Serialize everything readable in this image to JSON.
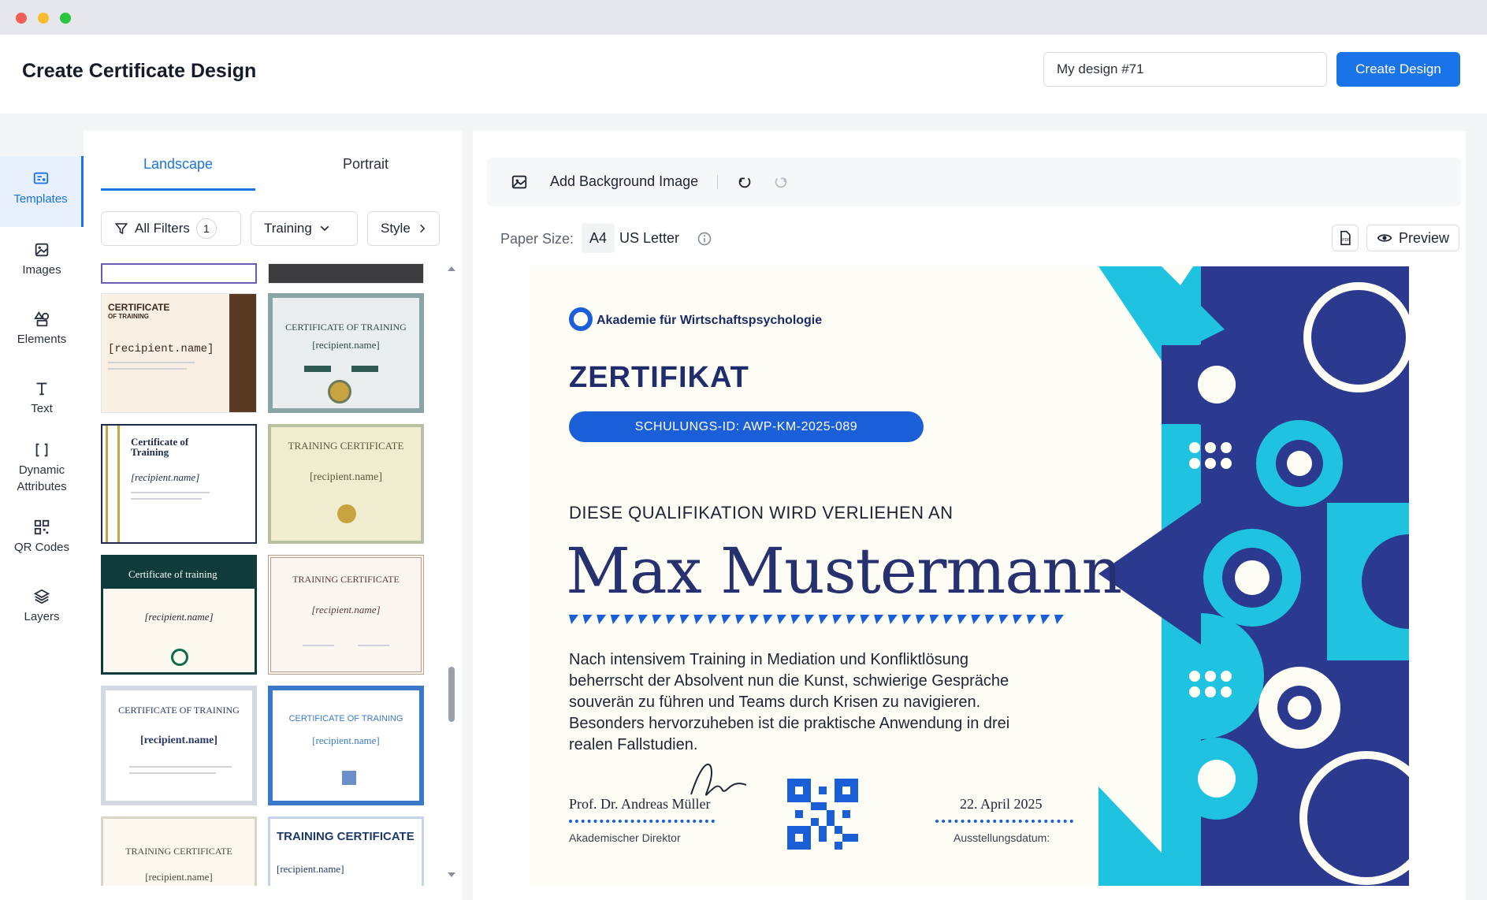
{
  "header": {
    "title": "Create Certificate Design",
    "design_name": "My design #71",
    "create_label": "Create Design"
  },
  "sidebar": {
    "items": [
      {
        "label": "Templates",
        "icon": "templates-icon"
      },
      {
        "label": "Images",
        "icon": "image-icon"
      },
      {
        "label": "Elements",
        "icon": "shapes-icon"
      },
      {
        "label": "Text",
        "icon": "text-icon"
      },
      {
        "label": "Dynamic\nAttributes",
        "icon": "brackets-icon"
      },
      {
        "label": "QR Codes",
        "icon": "qr-code-icon"
      },
      {
        "label": "Layers",
        "icon": "layers-icon"
      }
    ]
  },
  "panel": {
    "tabs": [
      "Landscape",
      "Portrait"
    ],
    "filters": {
      "all_label": "All Filters",
      "count": "1",
      "training": "Training",
      "style": "Style"
    },
    "templates": [
      {
        "title": "CERTIFICATE",
        "sub": "OF TRAINING",
        "name": "[recipient.name]"
      },
      {
        "title": "CERTIFICATE OF TRAINING",
        "name": "[recipient.name]"
      },
      {
        "title": "Certificate of Training",
        "name": "[recipient.name]"
      },
      {
        "title": "TRAINING CERTIFICATE",
        "name": "[recipient.name]"
      },
      {
        "title": "Certificate of training",
        "name": "[recipient.name]"
      },
      {
        "title": "TRAINING CERTIFICATE",
        "name": "[recipient.name]"
      },
      {
        "title": "CERTIFICATE OF TRAINING",
        "name": "[recipient.name]"
      },
      {
        "title": "CERTIFICATE OF TRAINING",
        "name": "[recipient.name]"
      },
      {
        "title": "TRAINING CERTIFICATE",
        "name": "[recipient.name]"
      },
      {
        "title": "TRAINING CERTIFICATE",
        "name": "[recipient.name]"
      }
    ]
  },
  "toolbar": {
    "add_bg": "Add Background Image",
    "paper_size_label": "Paper Size:",
    "paper_a4": "A4",
    "paper_us": "US Letter",
    "preview": "Preview"
  },
  "certificate": {
    "org": "Akademie für Wirtschaftspsychologie",
    "title": "ZERTIFIKAT",
    "id": "SCHULUNGS-ID: AWP-KM-2025-089",
    "awarded": "DIESE QUALIFIKATION WIRD VERLIEHEN AN",
    "recipient": "Max Mustermann",
    "body_lines": [
      "Nach intensivem Training in Mediation und Konfliktlösung",
      "beherrscht der Absolvent nun die Kunst, schwierige Gespräche",
      "souverän zu führen und Teams durch Krisen zu navigieren.",
      "Besonders hervorzuheben ist die praktische Anwendung in drei",
      "realen Fallstudien."
    ],
    "signer": "Prof. Dr. Andreas Müller",
    "signer_role": "Akademischer Direktor",
    "date": "22. April 2025",
    "date_label": "Ausstellungsdatum:",
    "colors": {
      "navy": "#27316f",
      "blue": "#1a5fd8",
      "cyan": "#1fc3e0",
      "cream": "#fdfcf5"
    }
  }
}
